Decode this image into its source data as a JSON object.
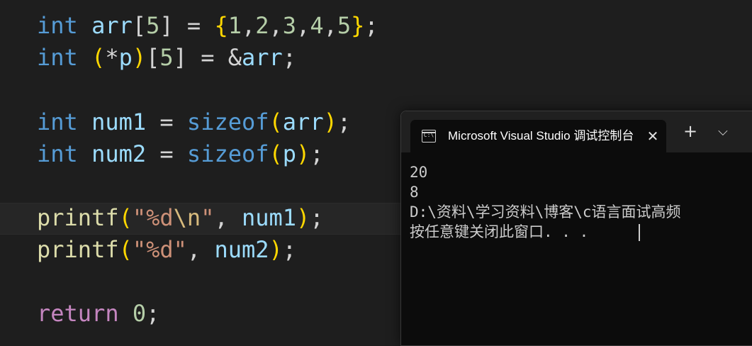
{
  "editor": {
    "lines": [
      [
        {
          "t": "int",
          "c": "kw"
        },
        {
          "t": " "
        },
        {
          "t": "arr",
          "c": "var"
        },
        {
          "t": "["
        },
        {
          "t": "5",
          "c": "num"
        },
        {
          "t": "] = "
        },
        {
          "t": "{",
          "c": "b1"
        },
        {
          "t": "1",
          "c": "num"
        },
        {
          "t": ","
        },
        {
          "t": "2",
          "c": "num"
        },
        {
          "t": ","
        },
        {
          "t": "3",
          "c": "num"
        },
        {
          "t": ","
        },
        {
          "t": "4",
          "c": "num"
        },
        {
          "t": ","
        },
        {
          "t": "5",
          "c": "num"
        },
        {
          "t": "}",
          "c": "b1"
        },
        {
          "t": ";"
        }
      ],
      [
        {
          "t": "int",
          "c": "kw"
        },
        {
          "t": " "
        },
        {
          "t": "(",
          "c": "b1"
        },
        {
          "t": "*"
        },
        {
          "t": "p",
          "c": "var"
        },
        {
          "t": ")",
          "c": "b1"
        },
        {
          "t": "["
        },
        {
          "t": "5",
          "c": "num"
        },
        {
          "t": "] = &"
        },
        {
          "t": "arr",
          "c": "var"
        },
        {
          "t": ";"
        }
      ],
      [],
      [
        {
          "t": "int",
          "c": "kw"
        },
        {
          "t": " "
        },
        {
          "t": "num1",
          "c": "var"
        },
        {
          "t": " = "
        },
        {
          "t": "sizeof",
          "c": "kw"
        },
        {
          "t": "(",
          "c": "b1"
        },
        {
          "t": "arr",
          "c": "var"
        },
        {
          "t": ")",
          "c": "b1"
        },
        {
          "t": ";"
        }
      ],
      [
        {
          "t": "int",
          "c": "kw"
        },
        {
          "t": " "
        },
        {
          "t": "num2",
          "c": "var"
        },
        {
          "t": " = "
        },
        {
          "t": "sizeof",
          "c": "kw"
        },
        {
          "t": "(",
          "c": "b1"
        },
        {
          "t": "p",
          "c": "var"
        },
        {
          "t": ")",
          "c": "b1"
        },
        {
          "t": ";"
        }
      ],
      [],
      [
        {
          "t": "printf",
          "c": "fn"
        },
        {
          "t": "(",
          "c": "b1"
        },
        {
          "t": "\"%d",
          "c": "str"
        },
        {
          "t": "\\n",
          "c": "esc"
        },
        {
          "t": "\"",
          "c": "str"
        },
        {
          "t": ", "
        },
        {
          "t": "num1",
          "c": "var"
        },
        {
          "t": ")",
          "c": "b1"
        },
        {
          "t": ";"
        }
      ],
      [
        {
          "t": "printf",
          "c": "fn"
        },
        {
          "t": "(",
          "c": "b1"
        },
        {
          "t": "\"%d\"",
          "c": "str"
        },
        {
          "t": ", "
        },
        {
          "t": "num2",
          "c": "var"
        },
        {
          "t": ")",
          "c": "b1"
        },
        {
          "t": ";"
        }
      ],
      [],
      [
        {
          "t": "return",
          "c": "ctl"
        },
        {
          "t": " "
        },
        {
          "t": "0",
          "c": "num"
        },
        {
          "t": ";"
        }
      ]
    ]
  },
  "terminal": {
    "tab_title": "Microsoft Visual Studio 调试控制台",
    "tab_icon_text": "C:\\",
    "close_glyph": "✕",
    "new_tab_glyph": "+",
    "dropdown_glyph": "⌵",
    "output": [
      "20",
      "8",
      "D:\\资料\\学习资料\\博客\\c语言面试高频",
      "按任意键关闭此窗口. . ."
    ]
  }
}
